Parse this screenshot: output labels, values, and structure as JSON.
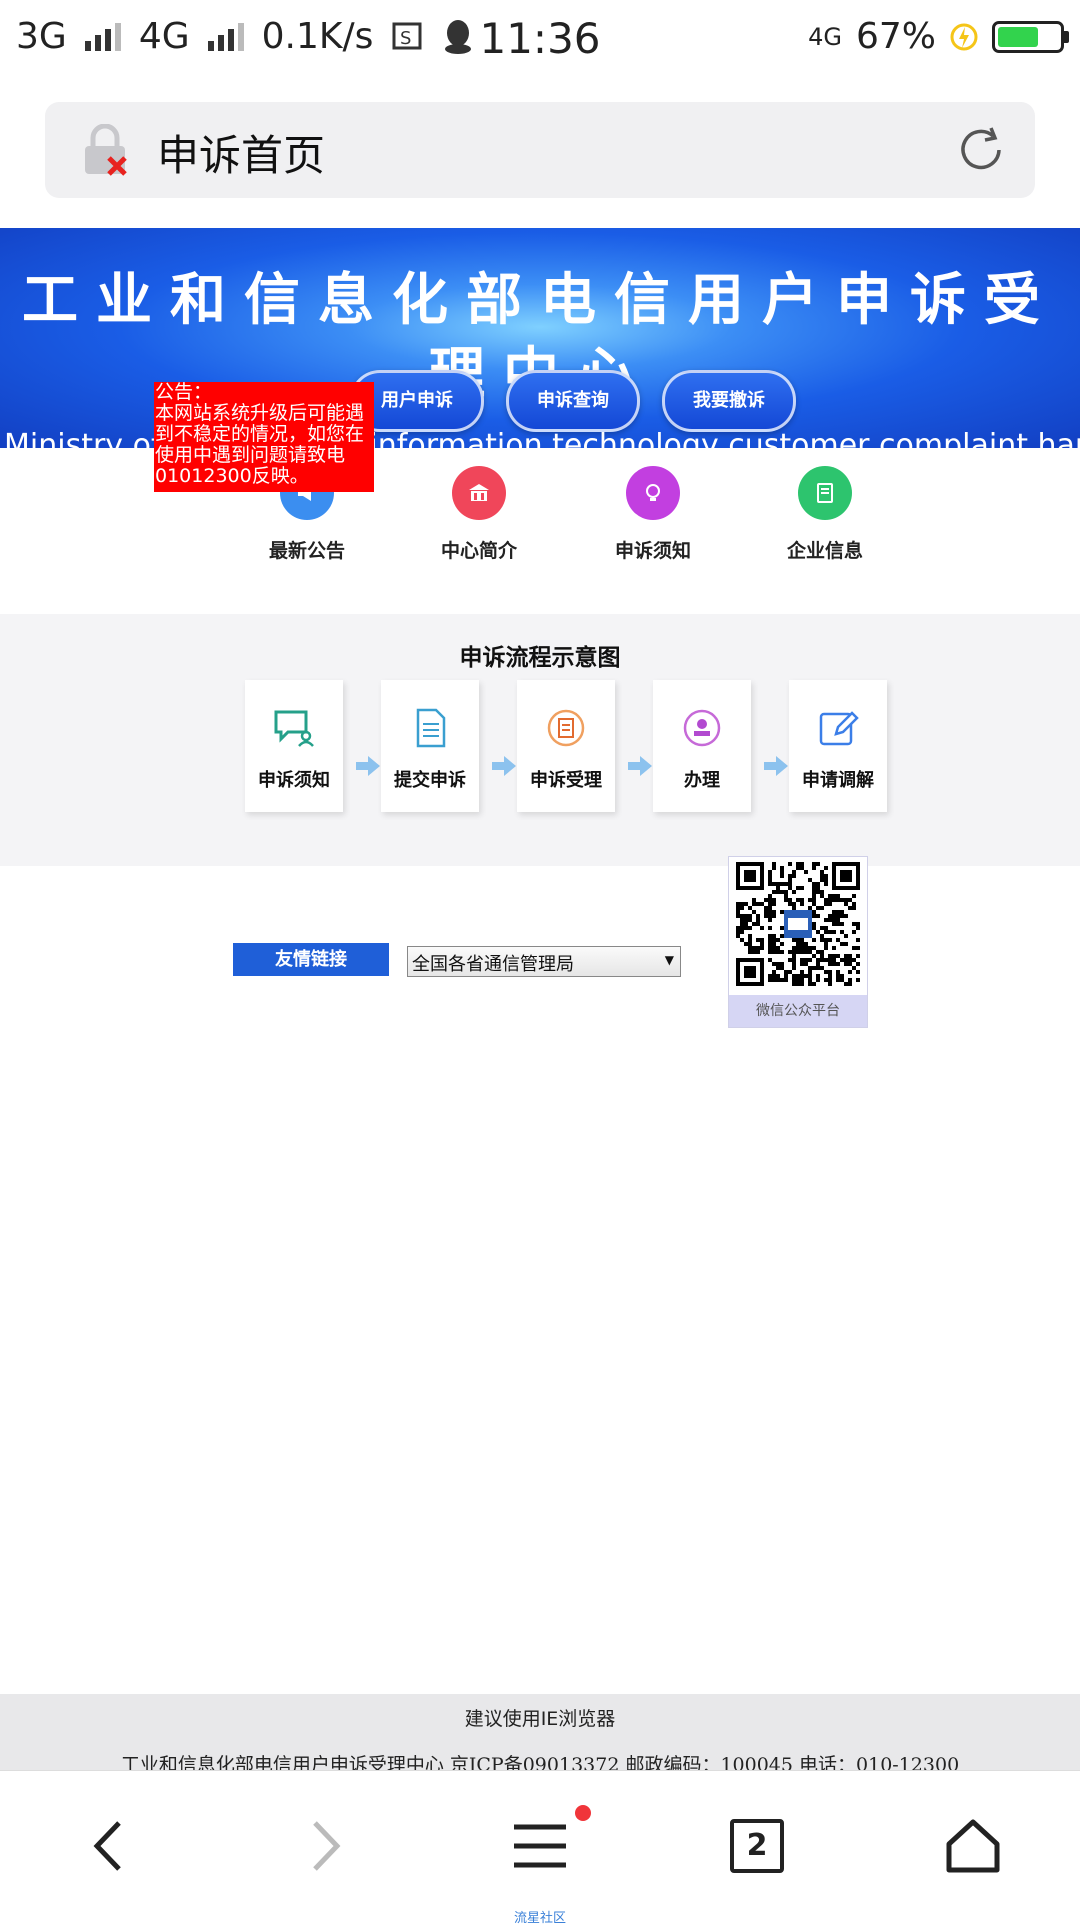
{
  "status_bar": {
    "network1": "3G",
    "network2": "4G",
    "speed": "0.1K/s",
    "time": "11:36",
    "net_right": "4G",
    "battery": "67%",
    "battery_level": 0.67,
    "battery_color": "#32d34d"
  },
  "address_bar": {
    "title": "申诉首页"
  },
  "banner": {
    "title": "工业和信息化部电信用户申诉受理中心",
    "subtitle": "Ministry of industry and information technology customer complaint handling center",
    "buttons": [
      "用户申诉",
      "申诉查询",
      "我要撤诉"
    ]
  },
  "notice": {
    "text": "公告：\n本网站系统升级后可能遇到不稳定的情况，如您在使用中遇到问题请致电01012300反映。"
  },
  "quick_links": [
    {
      "label": "最新公告",
      "color": "#3b8ef0",
      "icon": "megaphone-icon"
    },
    {
      "label": "中心简介",
      "color": "#f0465a",
      "icon": "building-icon"
    },
    {
      "label": "申诉须知",
      "color": "#c23fe0",
      "icon": "lightbulb-icon"
    },
    {
      "label": "企业信息",
      "color": "#2dc46e",
      "icon": "book-icon"
    }
  ],
  "flow": {
    "title": "申诉流程示意图",
    "steps": [
      {
        "label": "申诉须知",
        "icon": "chat-user-icon"
      },
      {
        "label": "提交申诉",
        "icon": "document-icon"
      },
      {
        "label": "申诉受理",
        "icon": "clipboard-icon"
      },
      {
        "label": "办理",
        "icon": "stamp-icon"
      },
      {
        "label": "申请调解",
        "icon": "edit-icon"
      }
    ]
  },
  "friend_links": {
    "label": "友情链接",
    "select_value": "全国各省通信管理局"
  },
  "qr": {
    "label": "微信公众平台"
  },
  "footer": {
    "line1": "建议使用IE浏览器",
    "line2": "工业和信息化部电信用户申诉受理中心 京ICP备09013372 邮政编码：100045 电话：010-12300"
  },
  "bottom_nav": {
    "tab_count": "2",
    "hint": "流星社区"
  }
}
